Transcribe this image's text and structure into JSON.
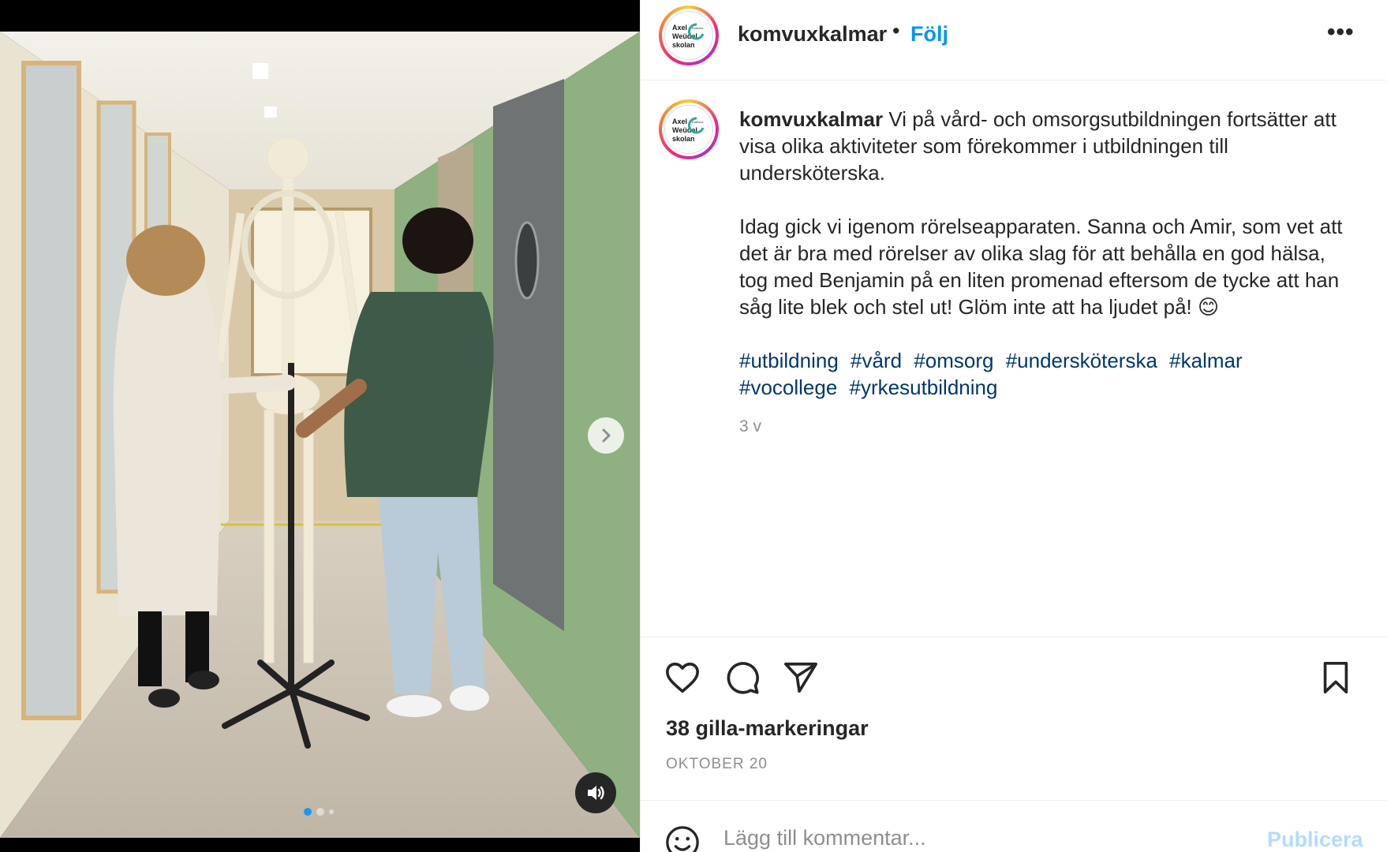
{
  "post": {
    "username": "komvuxkalmar",
    "follow_label": "Följ",
    "header_separator": "•",
    "more_label": "•••",
    "avatar_logo": {
      "line1": "Axel",
      "line2": "Weüdel",
      "line3": "skolan",
      "badge": "Komvux"
    }
  },
  "caption": {
    "username": "komvuxkalmar",
    "paragraph1": "Vi på vård- och omsorgsutbildningen fortsätter att visa olika aktiviteter som förekommer i utbildningen till undersköterska.",
    "paragraph2": "Idag gick vi igenom rörelseapparaten. Sanna och Amir, som vet att det är bra med rörelser av olika slag för att behålla en god hälsa, tog med Benjamin på en liten promenad eftersom de tycke att han såg lite blek och stel ut! Glöm inte att ha ljudet på!",
    "emoji": "😊",
    "hashtags": [
      "#utbildning",
      "#vård",
      "#omsorg",
      "#undersköterska",
      "#kalmar",
      "#vocollege",
      "#yrkesutbildning"
    ],
    "time_ago": "3 v"
  },
  "actions": {
    "like_icon": "heart-icon",
    "comment_icon": "comment-icon",
    "share_icon": "paper-plane-icon",
    "save_icon": "bookmark-icon"
  },
  "likes_text": "38 gilla-markeringar",
  "date_text": "OKTOBER 20",
  "comment": {
    "placeholder": "Lägg till kommentar...",
    "publish_label": "Publicera",
    "emoji_icon": "smiley-icon"
  },
  "media": {
    "next_icon": "chevron-right-icon",
    "sound_icon": "speaker-icon",
    "carousel_total": 3,
    "carousel_current": 1
  },
  "colors": {
    "link_blue": "#0095f6",
    "hashtag_blue": "#00376b",
    "muted": "#8e8e8e",
    "publish_disabled": "#b3dbff",
    "wall_green": "#8fb080"
  }
}
